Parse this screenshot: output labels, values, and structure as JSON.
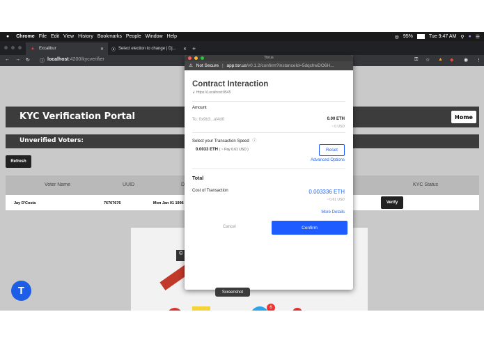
{
  "menubar": {
    "app": "Chrome",
    "items": [
      "File",
      "Edit",
      "View",
      "History",
      "Bookmarks",
      "People",
      "Window",
      "Help"
    ],
    "battery": "95%",
    "clock": "Tue 9:47 AM"
  },
  "tabs": [
    {
      "label": "Excalibur"
    },
    {
      "label": "Select election to change | Dj..."
    }
  ],
  "address": {
    "host": "localhost",
    "path": ":4200/kycverifier"
  },
  "page": {
    "title": "KYC Verification Portal",
    "home_label": "Home",
    "section": "Unverified Voters:",
    "refresh_label": "Refresh",
    "columns": [
      "Voter Name",
      "UUID",
      "D",
      "KYC Status"
    ],
    "row": {
      "name": "Jay D'Costa",
      "uuid": "76767676",
      "date": "Mon Jan 01 1996",
      "verify_label": "Verify"
    },
    "stray_glyph": "©"
  },
  "popup": {
    "window_title": "Torus",
    "not_secure": "Not Secure",
    "url_host": "app.tor.us",
    "url_path": "/v0.1.2/confirm?instanceId=5dqchwDO6H...",
    "heading": "Contract Interaction",
    "network": "Https://Localhost:8545",
    "amount_label": "Amount",
    "to": "To: 0x9b3...af4d0",
    "eth_amount": "0.00 ETH",
    "usd_amount": "~ 0 USD",
    "speed_label": "Select your Transaction Speed",
    "speed_value": "0.0033 ETH",
    "speed_usd": "( ~ Pay 0.61 USD )",
    "reset_label": "Reset",
    "advanced_label": "Advanced Options",
    "total_label": "Total",
    "cost_label": "Cost of Transaction",
    "cost_eth": "0.003336 ETH",
    "cost_usd": "~ 0.61 USD",
    "more_details": "More Details",
    "cancel_label": "Cancel",
    "confirm_label": "Confirm"
  },
  "tooltip": "Screenshot",
  "fab_letter": "T",
  "dock_badge": "6",
  "colors": {
    "accent": "#1f5cff",
    "menubar": "#1a1a1a",
    "portal_bar": "#3c3c3c"
  }
}
